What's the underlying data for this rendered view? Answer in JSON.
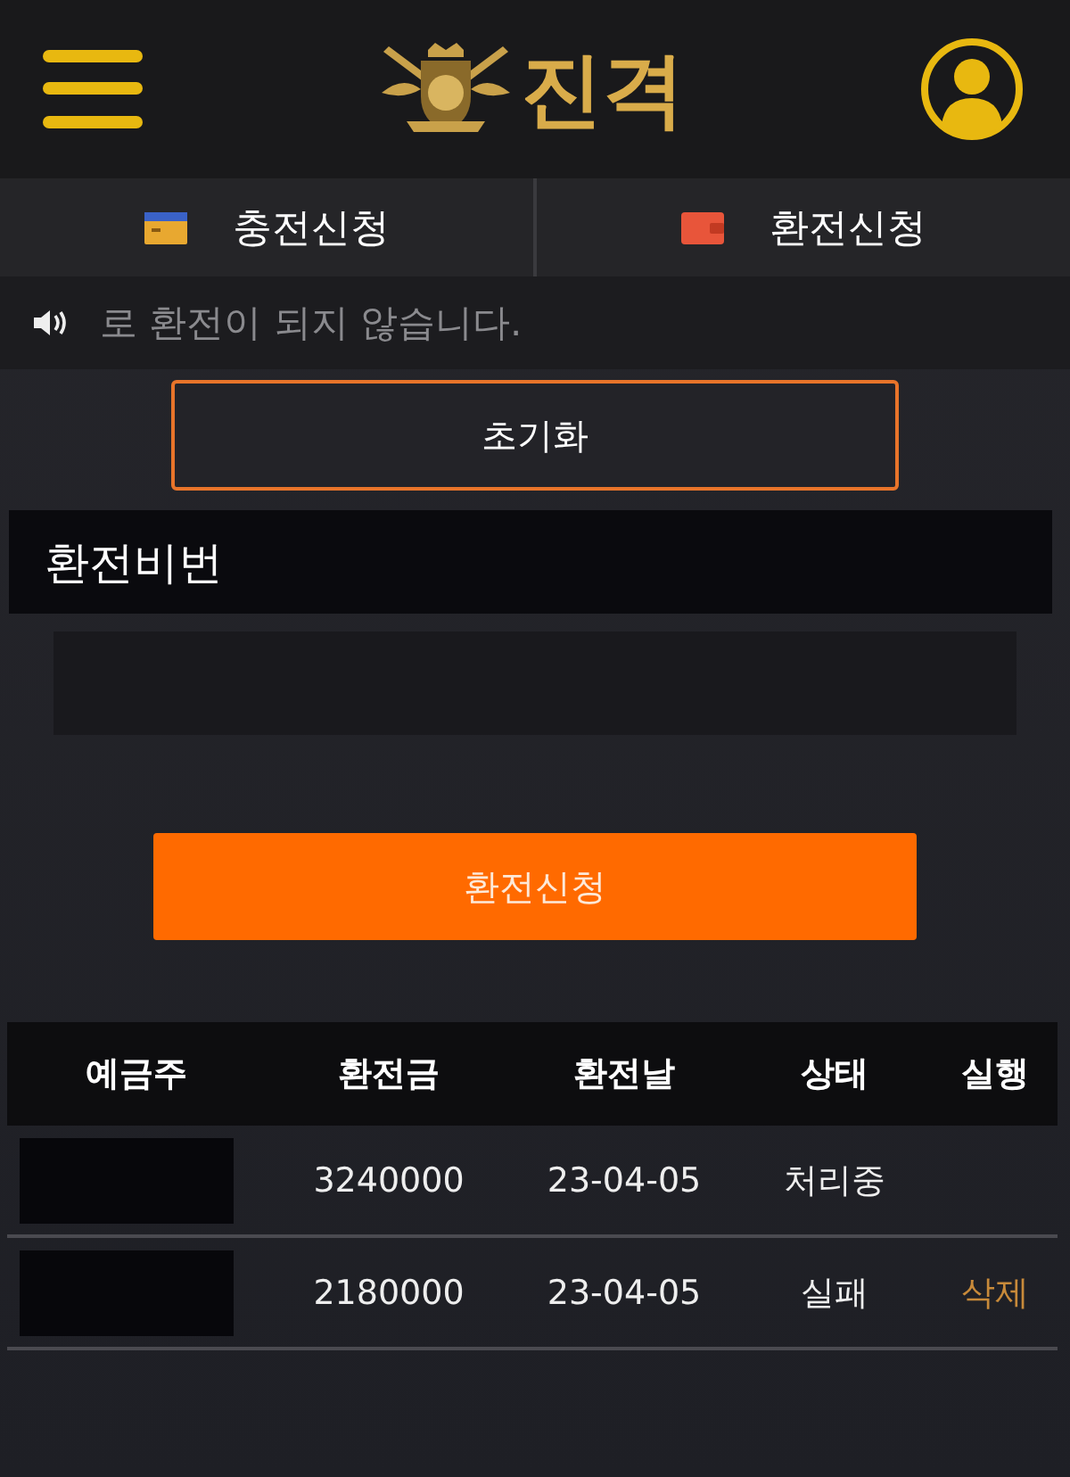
{
  "header": {
    "logo_text": "진격"
  },
  "tabs": [
    {
      "label": "충전신청",
      "kind": "card"
    },
    {
      "label": "환전신청",
      "kind": "wallet"
    }
  ],
  "notice": {
    "text": "로 환전이 되지 않습니다."
  },
  "reset_button": "초기화",
  "password_section": {
    "title": "환전비번"
  },
  "submit_button": "환전신청",
  "table": {
    "columns": [
      "예금주",
      "환전금",
      "환전날",
      "상태",
      "실행"
    ],
    "rows": [
      {
        "depositor_redacted": true,
        "amount": "3240000",
        "date": "23-04-05",
        "status": "처리중"
      },
      {
        "depositor_redacted": true,
        "amount": "2180000",
        "date": "23-04-05",
        "status": "실패",
        "action": "삭제"
      }
    ]
  }
}
